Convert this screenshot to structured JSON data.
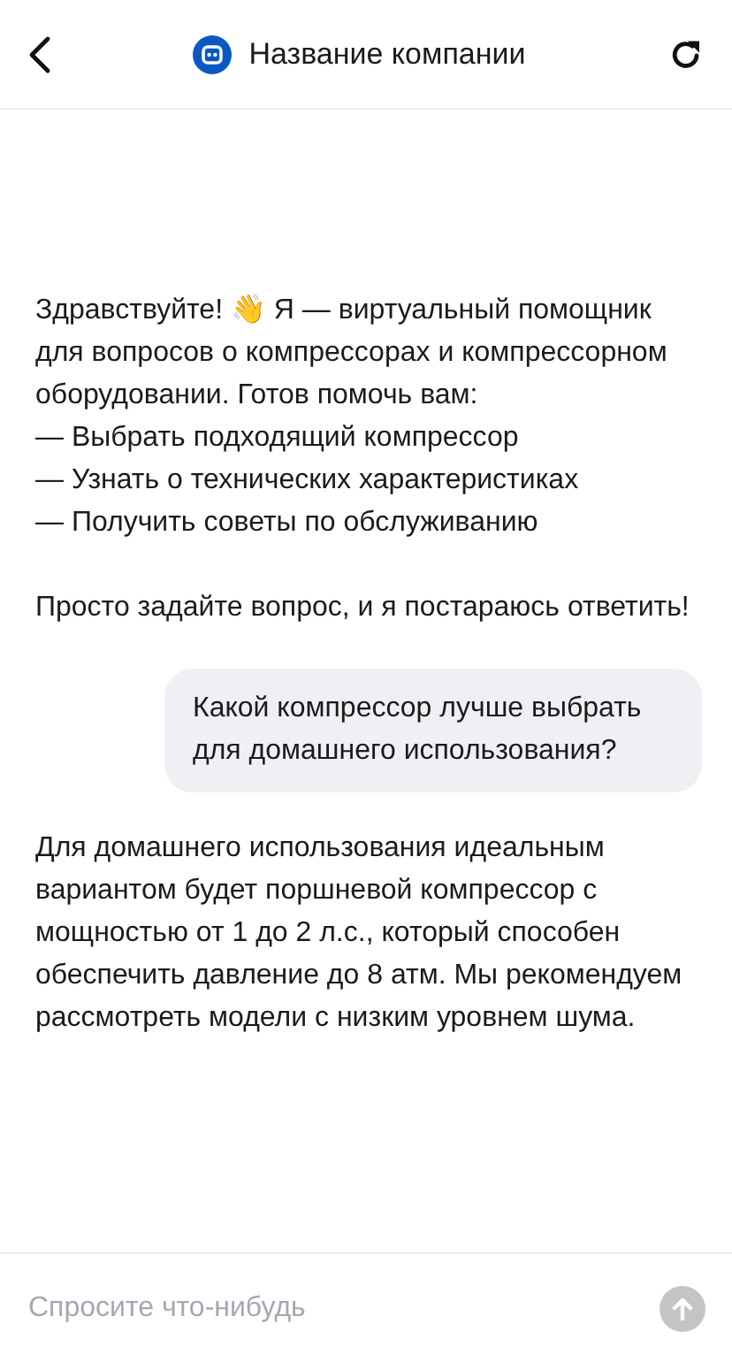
{
  "header": {
    "title": "Название компании"
  },
  "messages": [
    {
      "kind": "bot",
      "text": "Здравствуйте! 👋 Я — виртуальный помощник для вопросов о компрессорах и компрессорном оборудовании. Готов помочь вам:\n— Выбрать подходящий компрессор\n— Узнать о технических характеристиках\n— Получить советы по обслуживанию\n\nПросто задайте вопрос, и я постараюсь ответить!"
    },
    {
      "kind": "user",
      "text": "Какой компрессор лучше выбрать для домашнего использования?"
    },
    {
      "kind": "bot",
      "text": "Для домашнего использования идеальным вариантом будет поршневой компрессор с мощностью от 1 до 2 л.с., который способен обеспечить давление до 8 атм. Мы рекомендуем рассмотреть модели с низким уровнем шума."
    }
  ],
  "composer": {
    "placeholder": "Спросите что-нибудь",
    "send_disabled": true
  }
}
